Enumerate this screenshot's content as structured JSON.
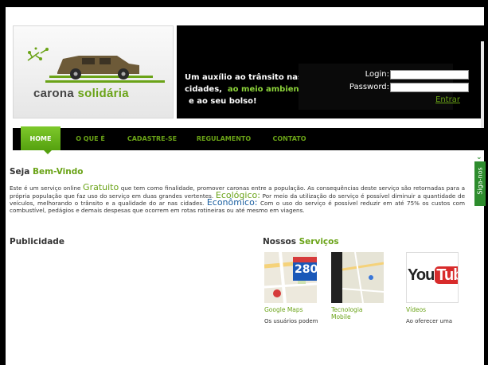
{
  "brand": {
    "logo_part1": "carona",
    "logo_part2": "solidária"
  },
  "slogan": {
    "line1": "Um auxílio ao trânsito nas",
    "line2a": "cidades,",
    "line2b": "ao meio ambiente",
    "line3": "e ao seu bolso!"
  },
  "login": {
    "login_label": "Login:",
    "password_label": "Password:",
    "login_value": "",
    "password_value": "",
    "submit_label": "Entrar"
  },
  "nav": {
    "items": [
      "HOME",
      "O QUE É",
      "CADASTRE-SE",
      "REGULAMENTO",
      "CONTATO"
    ],
    "active": "HOME"
  },
  "welcome": {
    "title_a": "Seja",
    "title_b": "Bem-Vindo",
    "p1": "Este é um serviço online",
    "k1": "Gratuito",
    "p2": "que tem como finalidade, promover caronas entre a população. As consequências deste serviço são retornadas para a própria população que faz uso do serviço em duas grandes vertentes.",
    "k2": "Ecológico:",
    "p3": "Por meio da utilização do serviço é possível diminuir a quantidade de veículos, melhorando o trânsito e a qualidade do ar nas cidades.",
    "k3": "Econômico:",
    "p4": "Com o uso do serviço é possível reduzir em até 75% os custos com combustível, pedágios e demais despesas que ocorrem em rotas rotineiras ou até mesmo em viagens."
  },
  "ads": {
    "title": "Publicidade"
  },
  "services": {
    "title_a": "Nossos",
    "title_b": "Serviços",
    "items": [
      {
        "title": "Google Maps",
        "desc": "Os usuários podem",
        "sign": "280"
      },
      {
        "title": "Tecnologia Mobile",
        "desc": ""
      },
      {
        "title": "Vídeos",
        "desc": "Ao oferecer uma",
        "logo_a": "You",
        "logo_b": "Tube"
      }
    ]
  },
  "social": {
    "label": "Siga-nos"
  },
  "colors": {
    "brand_green": "#6aa317",
    "nav_bg": "#000000",
    "blue_keyword": "#1a5fa0",
    "social_green": "#2d8c2d"
  }
}
